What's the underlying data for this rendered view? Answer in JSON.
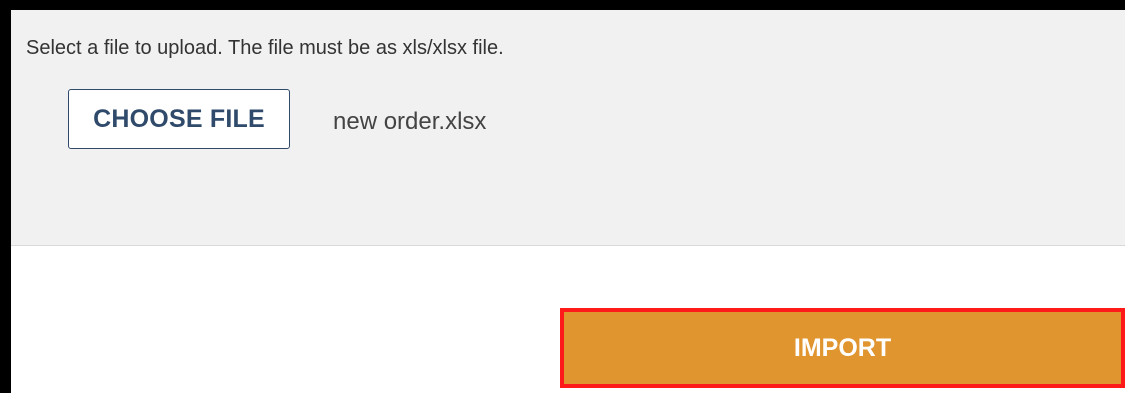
{
  "upload": {
    "instructions": "Select a file to upload. The file must be as xls/xlsx file.",
    "choose_file_label": "CHOOSE FILE",
    "file_name": "new order.xlsx"
  },
  "actions": {
    "import_label": "IMPORT"
  },
  "colors": {
    "import_button": "#e0952f",
    "import_highlight_border": "#ff1a1a",
    "choose_file_text": "#2f4a6b",
    "panel_background": "#f1f1f1"
  }
}
